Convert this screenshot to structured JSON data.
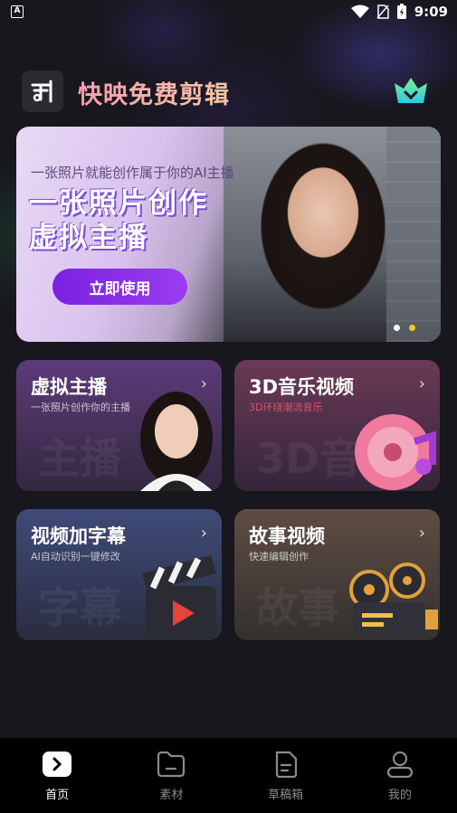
{
  "status_bar": {
    "time": "9:09",
    "left_icon": "A"
  },
  "header": {
    "app_title": "快映免费剪辑"
  },
  "banner": {
    "subtitle": "一张照片就能创作属于你的AI主播",
    "title_line1": "一张照片创作",
    "title_line2": "虚拟主播",
    "button_label": "立即使用",
    "page_count": 2,
    "active_page": 2
  },
  "cards": [
    {
      "title": "虚拟主播",
      "subtitle": "一张照片创作你的主播",
      "watermark": "主播",
      "icon": "avatar-portrait-icon"
    },
    {
      "title": "3D音乐视频",
      "subtitle": "3D环绕潮流音乐",
      "watermark": "3D音",
      "icon": "music-record-icon"
    },
    {
      "title": "视频加字幕",
      "subtitle": "AI自动识别一键修改",
      "watermark": "字幕",
      "icon": "clapperboard-icon"
    },
    {
      "title": "故事视频",
      "subtitle": "快速编辑创作",
      "watermark": "故事",
      "icon": "film-projector-icon"
    }
  ],
  "nav": [
    {
      "label": "首页",
      "icon": "play-home-icon",
      "active": true
    },
    {
      "label": "素材",
      "icon": "folder-icon",
      "active": false
    },
    {
      "label": "草稿箱",
      "icon": "document-icon",
      "active": false
    },
    {
      "label": "我的",
      "icon": "user-icon",
      "active": false
    }
  ],
  "colors": {
    "accent_purple": "#8a2be2",
    "dot_active": "#f3c623",
    "background": "#17171d"
  }
}
